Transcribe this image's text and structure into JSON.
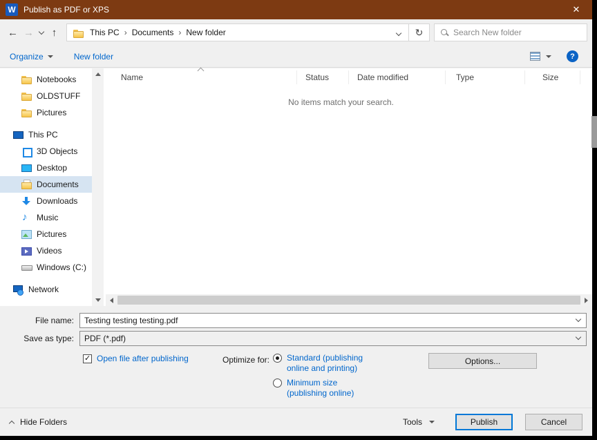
{
  "titlebar": {
    "title": "Publish as PDF or XPS",
    "app_letter": "W",
    "close_glyph": "✕"
  },
  "navbar": {
    "back_glyph": "←",
    "forward_glyph": "→",
    "up_glyph": "↑",
    "refresh_glyph": "↻",
    "breadcrumb": [
      "This PC",
      "Documents",
      "New folder"
    ],
    "crumb_separator": "›",
    "search_placeholder": "Search New folder"
  },
  "toolbar": {
    "organize_label": "Organize",
    "new_folder_label": "New folder",
    "help_glyph": "?"
  },
  "sidebar": {
    "items": [
      {
        "label": "Notebooks",
        "icon": "folder"
      },
      {
        "label": "OLDSTUFF",
        "icon": "folder"
      },
      {
        "label": "Pictures",
        "icon": "folder"
      },
      {
        "label": "This PC",
        "icon": "computer"
      },
      {
        "label": "3D Objects",
        "icon": "cube"
      },
      {
        "label": "Desktop",
        "icon": "desktop"
      },
      {
        "label": "Documents",
        "icon": "documents",
        "selected": true
      },
      {
        "label": "Downloads",
        "icon": "downloads"
      },
      {
        "label": "Music",
        "icon": "music"
      },
      {
        "label": "Pictures",
        "icon": "pictures"
      },
      {
        "label": "Videos",
        "icon": "videos"
      },
      {
        "label": "Windows (C:)",
        "icon": "drive"
      },
      {
        "label": "Network",
        "icon": "network"
      }
    ]
  },
  "filelist": {
    "columns": [
      "Name",
      "Status",
      "Date modified",
      "Type",
      "Size"
    ],
    "empty_message": "No items match your search."
  },
  "fields": {
    "file_name_label": "File name:",
    "file_name_value": "Testing testing testing.pdf",
    "save_type_label": "Save as type:",
    "save_type_value": "PDF (*.pdf)"
  },
  "options": {
    "open_after_label": "Open file after publishing",
    "optimize_label": "Optimize for:",
    "standard_label": "Standard (publishing online and printing)",
    "minimum_label": "Minimum size (publishing online)",
    "options_button_label": "Options..."
  },
  "footer": {
    "hide_folders_label": "Hide Folders",
    "tools_label": "Tools",
    "publish_label": "Publish",
    "cancel_label": "Cancel"
  },
  "colors": {
    "titlebar_bg": "#7d3a12",
    "accent_blue": "#0066cc",
    "selection_bg": "#d6e4f2",
    "publish_border": "#0078d7",
    "help_blue": "#0b63c5",
    "word_blue": "#185abd"
  }
}
